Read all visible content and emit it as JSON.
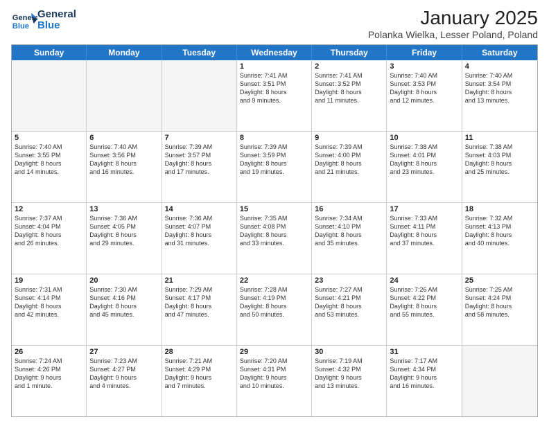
{
  "logo": {
    "line1": "General",
    "line2": "Blue"
  },
  "title": "January 2025",
  "subtitle": "Polanka Wielka, Lesser Poland, Poland",
  "days": [
    "Sunday",
    "Monday",
    "Tuesday",
    "Wednesday",
    "Thursday",
    "Friday",
    "Saturday"
  ],
  "rows": [
    [
      {
        "day": "",
        "info": ""
      },
      {
        "day": "",
        "info": ""
      },
      {
        "day": "",
        "info": ""
      },
      {
        "day": "1",
        "info": "Sunrise: 7:41 AM\nSunset: 3:51 PM\nDaylight: 8 hours\nand 9 minutes."
      },
      {
        "day": "2",
        "info": "Sunrise: 7:41 AM\nSunset: 3:52 PM\nDaylight: 8 hours\nand 11 minutes."
      },
      {
        "day": "3",
        "info": "Sunrise: 7:40 AM\nSunset: 3:53 PM\nDaylight: 8 hours\nand 12 minutes."
      },
      {
        "day": "4",
        "info": "Sunrise: 7:40 AM\nSunset: 3:54 PM\nDaylight: 8 hours\nand 13 minutes."
      }
    ],
    [
      {
        "day": "5",
        "info": "Sunrise: 7:40 AM\nSunset: 3:55 PM\nDaylight: 8 hours\nand 14 minutes."
      },
      {
        "day": "6",
        "info": "Sunrise: 7:40 AM\nSunset: 3:56 PM\nDaylight: 8 hours\nand 16 minutes."
      },
      {
        "day": "7",
        "info": "Sunrise: 7:39 AM\nSunset: 3:57 PM\nDaylight: 8 hours\nand 17 minutes."
      },
      {
        "day": "8",
        "info": "Sunrise: 7:39 AM\nSunset: 3:59 PM\nDaylight: 8 hours\nand 19 minutes."
      },
      {
        "day": "9",
        "info": "Sunrise: 7:39 AM\nSunset: 4:00 PM\nDaylight: 8 hours\nand 21 minutes."
      },
      {
        "day": "10",
        "info": "Sunrise: 7:38 AM\nSunset: 4:01 PM\nDaylight: 8 hours\nand 23 minutes."
      },
      {
        "day": "11",
        "info": "Sunrise: 7:38 AM\nSunset: 4:03 PM\nDaylight: 8 hours\nand 25 minutes."
      }
    ],
    [
      {
        "day": "12",
        "info": "Sunrise: 7:37 AM\nSunset: 4:04 PM\nDaylight: 8 hours\nand 26 minutes."
      },
      {
        "day": "13",
        "info": "Sunrise: 7:36 AM\nSunset: 4:05 PM\nDaylight: 8 hours\nand 29 minutes."
      },
      {
        "day": "14",
        "info": "Sunrise: 7:36 AM\nSunset: 4:07 PM\nDaylight: 8 hours\nand 31 minutes."
      },
      {
        "day": "15",
        "info": "Sunrise: 7:35 AM\nSunset: 4:08 PM\nDaylight: 8 hours\nand 33 minutes."
      },
      {
        "day": "16",
        "info": "Sunrise: 7:34 AM\nSunset: 4:10 PM\nDaylight: 8 hours\nand 35 minutes."
      },
      {
        "day": "17",
        "info": "Sunrise: 7:33 AM\nSunset: 4:11 PM\nDaylight: 8 hours\nand 37 minutes."
      },
      {
        "day": "18",
        "info": "Sunrise: 7:32 AM\nSunset: 4:13 PM\nDaylight: 8 hours\nand 40 minutes."
      }
    ],
    [
      {
        "day": "19",
        "info": "Sunrise: 7:31 AM\nSunset: 4:14 PM\nDaylight: 8 hours\nand 42 minutes."
      },
      {
        "day": "20",
        "info": "Sunrise: 7:30 AM\nSunset: 4:16 PM\nDaylight: 8 hours\nand 45 minutes."
      },
      {
        "day": "21",
        "info": "Sunrise: 7:29 AM\nSunset: 4:17 PM\nDaylight: 8 hours\nand 47 minutes."
      },
      {
        "day": "22",
        "info": "Sunrise: 7:28 AM\nSunset: 4:19 PM\nDaylight: 8 hours\nand 50 minutes."
      },
      {
        "day": "23",
        "info": "Sunrise: 7:27 AM\nSunset: 4:21 PM\nDaylight: 8 hours\nand 53 minutes."
      },
      {
        "day": "24",
        "info": "Sunrise: 7:26 AM\nSunset: 4:22 PM\nDaylight: 8 hours\nand 55 minutes."
      },
      {
        "day": "25",
        "info": "Sunrise: 7:25 AM\nSunset: 4:24 PM\nDaylight: 8 hours\nand 58 minutes."
      }
    ],
    [
      {
        "day": "26",
        "info": "Sunrise: 7:24 AM\nSunset: 4:26 PM\nDaylight: 9 hours\nand 1 minute."
      },
      {
        "day": "27",
        "info": "Sunrise: 7:23 AM\nSunset: 4:27 PM\nDaylight: 9 hours\nand 4 minutes."
      },
      {
        "day": "28",
        "info": "Sunrise: 7:21 AM\nSunset: 4:29 PM\nDaylight: 9 hours\nand 7 minutes."
      },
      {
        "day": "29",
        "info": "Sunrise: 7:20 AM\nSunset: 4:31 PM\nDaylight: 9 hours\nand 10 minutes."
      },
      {
        "day": "30",
        "info": "Sunrise: 7:19 AM\nSunset: 4:32 PM\nDaylight: 9 hours\nand 13 minutes."
      },
      {
        "day": "31",
        "info": "Sunrise: 7:17 AM\nSunset: 4:34 PM\nDaylight: 9 hours\nand 16 minutes."
      },
      {
        "day": "",
        "info": ""
      }
    ]
  ]
}
